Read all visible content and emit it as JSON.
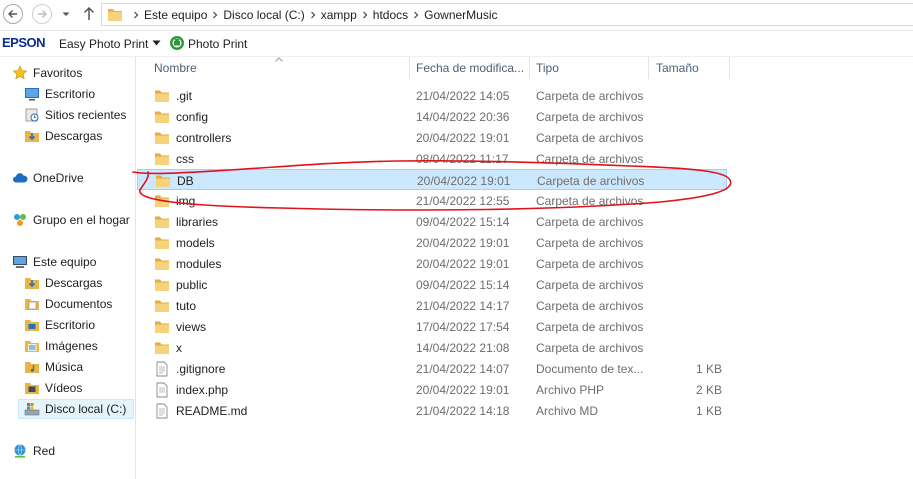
{
  "address": {
    "breadcrumbs": [
      "Este equipo",
      "Disco local (C:)",
      "xampp",
      "htdocs",
      "GownerMusic"
    ]
  },
  "toolbar": {
    "brand": "EPSON",
    "easy_photo_print": "Easy Photo Print",
    "photo_print": "Photo Print"
  },
  "sidebar": {
    "favorites": "Favoritos",
    "favorites_items": [
      {
        "label": "Escritorio",
        "icon": "desktop-icon"
      },
      {
        "label": "Sitios recientes",
        "icon": "recent-places-icon"
      },
      {
        "label": "Descargas",
        "icon": "downloads-icon"
      }
    ],
    "onedrive": "OneDrive",
    "homegroup": "Grupo en el hogar",
    "this_pc": "Este equipo",
    "this_pc_items": [
      {
        "label": "Descargas",
        "icon": "downloads-icon"
      },
      {
        "label": "Documentos",
        "icon": "documents-icon"
      },
      {
        "label": "Escritorio",
        "icon": "desktop-icon"
      },
      {
        "label": "Imágenes",
        "icon": "pictures-icon"
      },
      {
        "label": "Música",
        "icon": "music-icon"
      },
      {
        "label": "Vídeos",
        "icon": "videos-icon"
      },
      {
        "label": "Disco local (C:)",
        "icon": "local-disk-icon"
      }
    ],
    "network": "Red"
  },
  "columns": {
    "name": "Nombre",
    "date": "Fecha de modifica...",
    "type": "Tipo",
    "size": "Tamaño"
  },
  "files": [
    {
      "name": ".git",
      "date": "21/04/2022 14:05",
      "type": "Carpeta de archivos",
      "size": "",
      "icon": "folder-icon"
    },
    {
      "name": "config",
      "date": "14/04/2022 20:36",
      "type": "Carpeta de archivos",
      "size": "",
      "icon": "folder-icon"
    },
    {
      "name": "controllers",
      "date": "20/04/2022 19:01",
      "type": "Carpeta de archivos",
      "size": "",
      "icon": "folder-icon"
    },
    {
      "name": "css",
      "date": "08/04/2022 11:17",
      "type": "Carpeta de archivos",
      "size": "",
      "icon": "folder-icon"
    },
    {
      "name": "DB",
      "date": "20/04/2022 19:01",
      "type": "Carpeta de archivos",
      "size": "",
      "icon": "folder-icon"
    },
    {
      "name": "img",
      "date": "21/04/2022 12:55",
      "type": "Carpeta de archivos",
      "size": "",
      "icon": "folder-icon"
    },
    {
      "name": "libraries",
      "date": "09/04/2022 15:14",
      "type": "Carpeta de archivos",
      "size": "",
      "icon": "folder-icon"
    },
    {
      "name": "models",
      "date": "20/04/2022 19:01",
      "type": "Carpeta de archivos",
      "size": "",
      "icon": "folder-icon"
    },
    {
      "name": "modules",
      "date": "20/04/2022 19:01",
      "type": "Carpeta de archivos",
      "size": "",
      "icon": "folder-icon"
    },
    {
      "name": "public",
      "date": "09/04/2022 15:14",
      "type": "Carpeta de archivos",
      "size": "",
      "icon": "folder-icon"
    },
    {
      "name": "tuto",
      "date": "21/04/2022 14:17",
      "type": "Carpeta de archivos",
      "size": "",
      "icon": "folder-icon"
    },
    {
      "name": "views",
      "date": "17/04/2022 17:54",
      "type": "Carpeta de archivos",
      "size": "",
      "icon": "folder-icon"
    },
    {
      "name": "x",
      "date": "14/04/2022 21:08",
      "type": "Carpeta de archivos",
      "size": "",
      "icon": "folder-icon"
    },
    {
      "name": ".gitignore",
      "date": "21/04/2022 14:07",
      "type": "Documento de tex...",
      "size": "1 KB",
      "icon": "text-file-icon"
    },
    {
      "name": "index.php",
      "date": "20/04/2022 19:01",
      "type": "Archivo PHP",
      "size": "2 KB",
      "icon": "php-file-icon"
    },
    {
      "name": "README.md",
      "date": "21/04/2022 14:18",
      "type": "Archivo MD",
      "size": "1 KB",
      "icon": "text-file-icon"
    }
  ],
  "selected_index": 4,
  "colors": {
    "selection": "#cce8ff",
    "selection_border": "#99d1ff",
    "annotation": "#e0121b",
    "folder": "#f2c55c"
  }
}
